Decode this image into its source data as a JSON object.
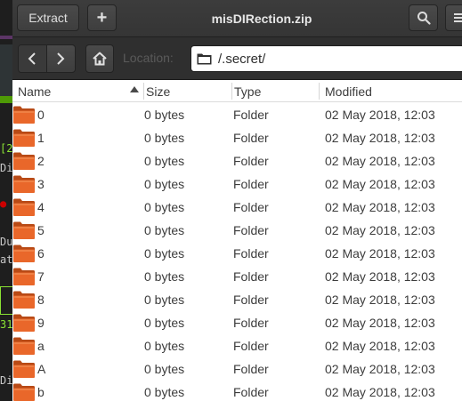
{
  "window": {
    "title": "misDIRection.zip"
  },
  "header": {
    "extract_label": "Extract",
    "add_label": "+",
    "search_icon": "search-icon",
    "menu_icon": "hamburger-menu-icon"
  },
  "toolbar": {
    "back_icon": "chevron-left-icon",
    "forward_icon": "chevron-right-icon",
    "home_icon": "home-icon",
    "location_label": "Location:",
    "path": "/.secret/"
  },
  "columns": {
    "name": "Name",
    "size": "Size",
    "type": "Type",
    "modified": "Modified"
  },
  "files": [
    {
      "name": "0",
      "size": "0 bytes",
      "type": "Folder",
      "modified": "02 May 2018, 12:03"
    },
    {
      "name": "1",
      "size": "0 bytes",
      "type": "Folder",
      "modified": "02 May 2018, 12:03"
    },
    {
      "name": "2",
      "size": "0 bytes",
      "type": "Folder",
      "modified": "02 May 2018, 12:03"
    },
    {
      "name": "3",
      "size": "0 bytes",
      "type": "Folder",
      "modified": "02 May 2018, 12:03"
    },
    {
      "name": "4",
      "size": "0 bytes",
      "type": "Folder",
      "modified": "02 May 2018, 12:03"
    },
    {
      "name": "5",
      "size": "0 bytes",
      "type": "Folder",
      "modified": "02 May 2018, 12:03"
    },
    {
      "name": "6",
      "size": "0 bytes",
      "type": "Folder",
      "modified": "02 May 2018, 12:03"
    },
    {
      "name": "7",
      "size": "0 bytes",
      "type": "Folder",
      "modified": "02 May 2018, 12:03"
    },
    {
      "name": "8",
      "size": "0 bytes",
      "type": "Folder",
      "modified": "02 May 2018, 12:03"
    },
    {
      "name": "9",
      "size": "0 bytes",
      "type": "Folder",
      "modified": "02 May 2018, 12:03"
    },
    {
      "name": "a",
      "size": "0 bytes",
      "type": "Folder",
      "modified": "02 May 2018, 12:03"
    },
    {
      "name": "A",
      "size": "0 bytes",
      "type": "Folder",
      "modified": "02 May 2018, 12:03"
    },
    {
      "name": "b",
      "size": "0 bytes",
      "type": "Folder",
      "modified": "02 May 2018, 12:03"
    }
  ],
  "background_terminal": {
    "fragments": [
      "[2",
      "Di",
      "Du",
      "at",
      "31",
      "Di"
    ]
  },
  "colors": {
    "folder_orange": "#e9672a",
    "headerbar": "#3a3a3a",
    "accent_green": "#8ae234"
  }
}
